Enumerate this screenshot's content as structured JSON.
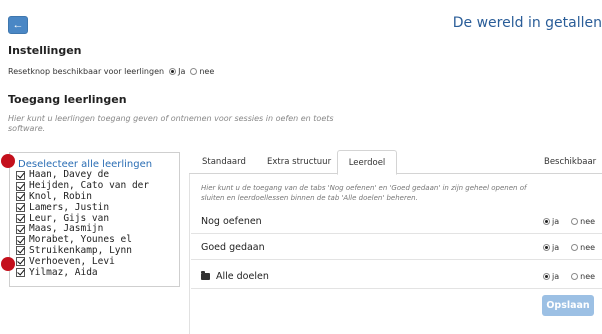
{
  "header": {
    "back_icon": "arrow-left-icon",
    "title": "De wereld in getallen"
  },
  "settings": {
    "heading": "Instellingen",
    "reset_label": "Resetknop beschikbaar voor leerlingen",
    "option_yes": "Ja",
    "option_no": "nee",
    "selected": "Ja"
  },
  "access": {
    "heading": "Toegang leerlingen",
    "description": "Hier kunt u leerlingen toegang geven of ontnemen voor sessies in oefen en toets software."
  },
  "students": {
    "deselect_label": "Deselecteer alle leerlingen",
    "items": [
      {
        "name": "Haan, Davey de",
        "checked": true
      },
      {
        "name": "Heijden, Cato van der",
        "checked": true
      },
      {
        "name": "Knol, Robin",
        "checked": true
      },
      {
        "name": "Lamers, Justin",
        "checked": true
      },
      {
        "name": "Leur, Gijs van",
        "checked": true
      },
      {
        "name": "Maas, Jasmijn",
        "checked": true
      },
      {
        "name": "Morabet, Younes el",
        "checked": true
      },
      {
        "name": "Struikenkamp, Lynn",
        "checked": true
      },
      {
        "name": "Verhoeven, Levi",
        "checked": true
      },
      {
        "name": "Yilmaz, Aida",
        "checked": true
      }
    ]
  },
  "markers": {
    "color": "#c4101c"
  },
  "tabs": {
    "items": [
      {
        "label": "Standaard",
        "active": false
      },
      {
        "label": "Extra structuur",
        "active": false
      },
      {
        "label": "Leerdoel",
        "active": true
      },
      {
        "label": "Beschikbaar",
        "active": false
      }
    ],
    "content": {
      "description": "Hier kunt u de toegang van de tabs 'Nog oefenen' en 'Goed gedaan' in zijn geheel openen of sluiten en leerdoellessen binnen de tab 'Alle doelen' beheren.",
      "rows": [
        {
          "label": "Nog oefenen",
          "icon": null,
          "option_yes": "ja",
          "option_no": "nee",
          "selected": "ja"
        },
        {
          "label": "Goed gedaan",
          "icon": null,
          "option_yes": "ja",
          "option_no": "nee",
          "selected": "ja"
        },
        {
          "label": "Alle doelen",
          "icon": "folder-icon",
          "option_yes": "ja",
          "option_no": "nee",
          "selected": "ja"
        }
      ],
      "save_label": "Opslaan"
    }
  },
  "colors": {
    "primary": "#4a87c5",
    "link": "#2a6db4",
    "title": "#2a5d98",
    "save_disabled": "#9cc0e4"
  }
}
